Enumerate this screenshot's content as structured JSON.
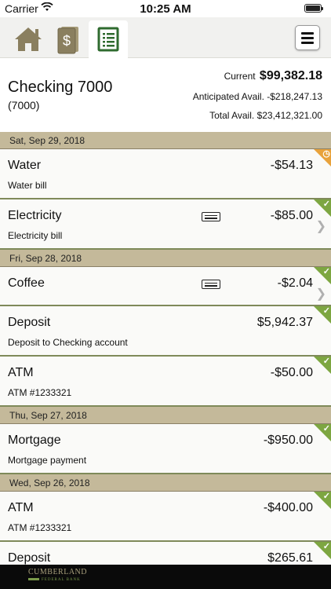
{
  "status_bar": {
    "carrier": "Carrier",
    "time": "10:25 AM"
  },
  "nav": {
    "tabs": [
      {
        "icon": "home-icon",
        "active": false
      },
      {
        "icon": "money-transfer-icon",
        "active": false
      },
      {
        "icon": "account-ledger-icon",
        "active": true
      }
    ],
    "menu_icon": "hamburger-menu-icon"
  },
  "account": {
    "title": "Checking 7000",
    "subtitle": "(7000)",
    "current_label": "Current",
    "current_value": "$99,382.18",
    "anticipated_label": "Anticipated Avail.",
    "anticipated_value": "-$218,247.13",
    "total_label": "Total Avail.",
    "total_value": "$23,412,321.00"
  },
  "groups": [
    {
      "date": "Sat, Sep 29, 2018",
      "transactions": [
        {
          "name": "Water",
          "memo": "Water bill",
          "amount": "-$54.13",
          "status": "pending",
          "receipt": false,
          "chevron": false
        },
        {
          "name": "Electricity",
          "memo": "Electricity bill",
          "amount": "-$85.00",
          "status": "cleared",
          "receipt": true,
          "chevron": true
        }
      ]
    },
    {
      "date": "Fri, Sep 28, 2018",
      "transactions": [
        {
          "name": "Coffee",
          "memo": "",
          "amount": "-$2.04",
          "status": "cleared",
          "receipt": true,
          "chevron": true
        },
        {
          "name": "Deposit",
          "memo": "Deposit to Checking account",
          "amount": "$5,942.37",
          "status": "cleared",
          "receipt": false,
          "chevron": false
        },
        {
          "name": "ATM",
          "memo": "ATM #1233321",
          "amount": "-$50.00",
          "status": "cleared",
          "receipt": false,
          "chevron": false
        }
      ]
    },
    {
      "date": "Thu, Sep 27, 2018",
      "transactions": [
        {
          "name": "Mortgage",
          "memo": "Mortgage payment",
          "amount": "-$950.00",
          "status": "cleared",
          "receipt": false,
          "chevron": false
        }
      ]
    },
    {
      "date": "Wed, Sep 26, 2018",
      "transactions": [
        {
          "name": "ATM",
          "memo": "ATM #1233321",
          "amount": "-$400.00",
          "status": "cleared",
          "receipt": false,
          "chevron": false
        },
        {
          "name": "Deposit",
          "memo": "",
          "amount": "$265.61",
          "status": "cleared",
          "receipt": false,
          "chevron": false
        }
      ]
    }
  ],
  "footer": {
    "logo_text": "CUMBERLAND",
    "logo_sub": "FEDERAL BANK"
  },
  "colors": {
    "header_tan": "#c4b99a",
    "cleared_green": "#7da641",
    "pending_orange": "#e8a23b",
    "ledger_green": "#2f6b2f"
  }
}
